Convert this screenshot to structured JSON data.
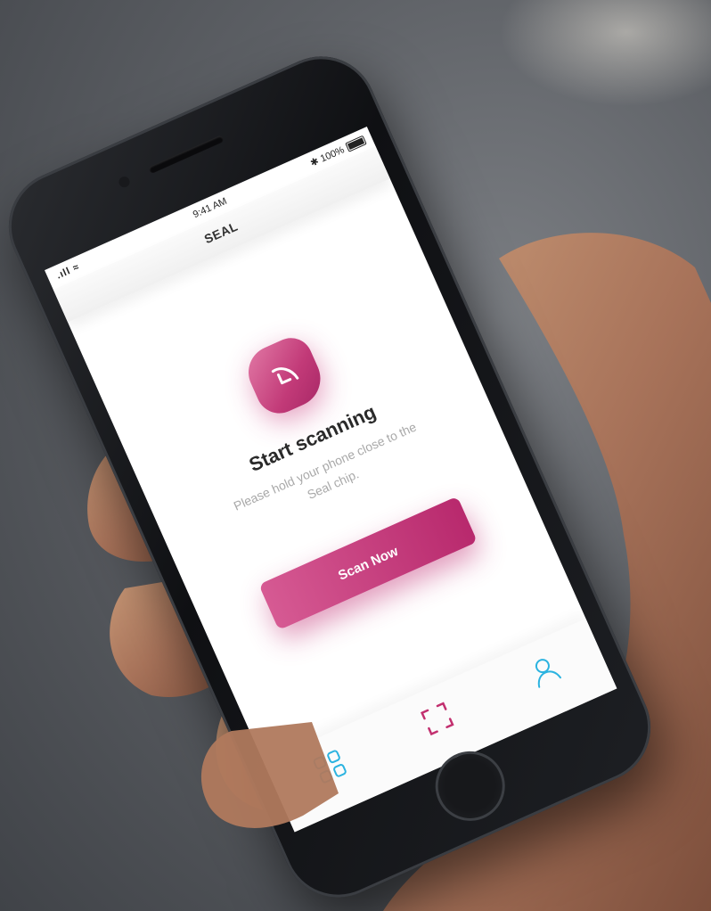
{
  "status_bar": {
    "time": "9:41 AM",
    "battery": "100%",
    "bluetooth": "bluetooth-icon",
    "signal": "signal-wifi-icon"
  },
  "nav": {
    "title": "SEAL"
  },
  "main": {
    "icon": "seal-chip-icon",
    "title": "Start scanning",
    "subtitle": "Please hold your phone close to the Seal chip.",
    "scan_button": "Scan Now"
  },
  "tab_bar": {
    "items": [
      {
        "icon": "dashboard-grid-icon",
        "active": true
      },
      {
        "icon": "scan-frame-icon",
        "active": false
      },
      {
        "icon": "user-profile-icon",
        "active": false
      }
    ]
  },
  "colors": {
    "accent": "#c2306f",
    "accent_light": "#e27aa6",
    "tab_active": "#2bb3e0",
    "tab_scan": "#c2306f"
  }
}
